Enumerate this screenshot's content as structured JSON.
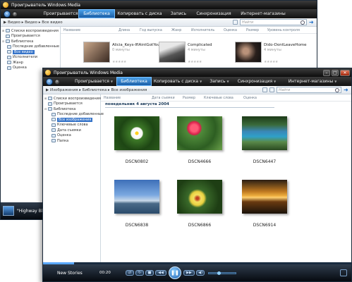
{
  "back": {
    "title": "Проигрыватель Windows Media",
    "tabs": [
      {
        "label": "Проигрывается",
        "active": false
      },
      {
        "label": "Библиотека",
        "active": true
      },
      {
        "label": "Копировать с диска",
        "active": false
      },
      {
        "label": "Запись",
        "active": false
      },
      {
        "label": "Синхронизация",
        "active": false
      },
      {
        "label": "Интернет-магазины",
        "active": false
      }
    ],
    "breadcrumb": "▶ Видео ▸ Видео ▸ Все видео",
    "search_placeholder": "Найти",
    "columns": [
      "Название",
      "Длина",
      "Год выпуска",
      "Жанр",
      "Исполнитель",
      "Оценка",
      "Размер",
      "Уровень контроля"
    ],
    "sidebar": [
      {
        "label": "Списки воспроизведения",
        "level": 0,
        "selected": false
      },
      {
        "label": "Проигрывается",
        "level": 0,
        "selected": false
      },
      {
        "label": "Библиотека",
        "level": 0,
        "selected": false
      },
      {
        "label": "Последние добавленные",
        "level": 1,
        "selected": false
      },
      {
        "label": "Все видео",
        "level": 1,
        "selected": true
      },
      {
        "label": "Исполнители",
        "level": 1,
        "selected": false
      },
      {
        "label": "Жанр",
        "level": 1,
        "selected": false
      },
      {
        "label": "Оценка",
        "level": 1,
        "selected": false
      }
    ],
    "videos": [
      {
        "title": "Alicia_Keys-IfIAintGotYou",
        "sub": "0 минуты"
      },
      {
        "title": "Complicated",
        "sub": "4 минуты"
      },
      {
        "title": "Dido-DontLeaveHome",
        "sub": "4 минуты"
      }
    ],
    "now_playing": "\"Highway Blues\""
  },
  "front": {
    "title": "Проигрыватель Windows Media",
    "tabs": [
      {
        "label": "Проигрывается",
        "active": false
      },
      {
        "label": "Библиотека",
        "active": true
      },
      {
        "label": "Копировать с диска",
        "active": false
      },
      {
        "label": "Запись",
        "active": false
      },
      {
        "label": "Синхронизация",
        "active": false
      },
      {
        "label": "Интернет-магазины",
        "active": false
      }
    ],
    "breadcrumb": "▶ Изображения ▸ Библиотека ▸ Все изображения",
    "search_placeholder": "Найти",
    "columns": [
      "Название",
      "Дата съемки",
      "Размер",
      "Ключевые слова",
      "Оценка"
    ],
    "date_group": "понедельник 4 августа 2004",
    "sidebar": [
      {
        "label": "Списки воспроизведения",
        "level": 0,
        "selected": false
      },
      {
        "label": "Проигрывается",
        "level": 0,
        "selected": false
      },
      {
        "label": "Библиотека",
        "level": 0,
        "selected": false
      },
      {
        "label": "Последние добавленные",
        "level": 1,
        "selected": false
      },
      {
        "label": "Все изображения",
        "level": 1,
        "selected": true
      },
      {
        "label": "Ключевые слова",
        "level": 1,
        "selected": false
      },
      {
        "label": "Дата съемки",
        "level": 1,
        "selected": false
      },
      {
        "label": "Оценка",
        "level": 1,
        "selected": false
      },
      {
        "label": "Папка",
        "level": 1,
        "selected": false
      }
    ],
    "photos": [
      {
        "name": "DSCN0802"
      },
      {
        "name": "DSCN4666"
      },
      {
        "name": "DSCN6447"
      },
      {
        "name": "DSCN6838"
      },
      {
        "name": "DSCN6866"
      },
      {
        "name": "DSCN6914"
      }
    ],
    "now_playing": "New Stories",
    "time": "00:20"
  },
  "colors": {
    "accent": "#2b7fd4",
    "dark": "#0c0c0c"
  }
}
